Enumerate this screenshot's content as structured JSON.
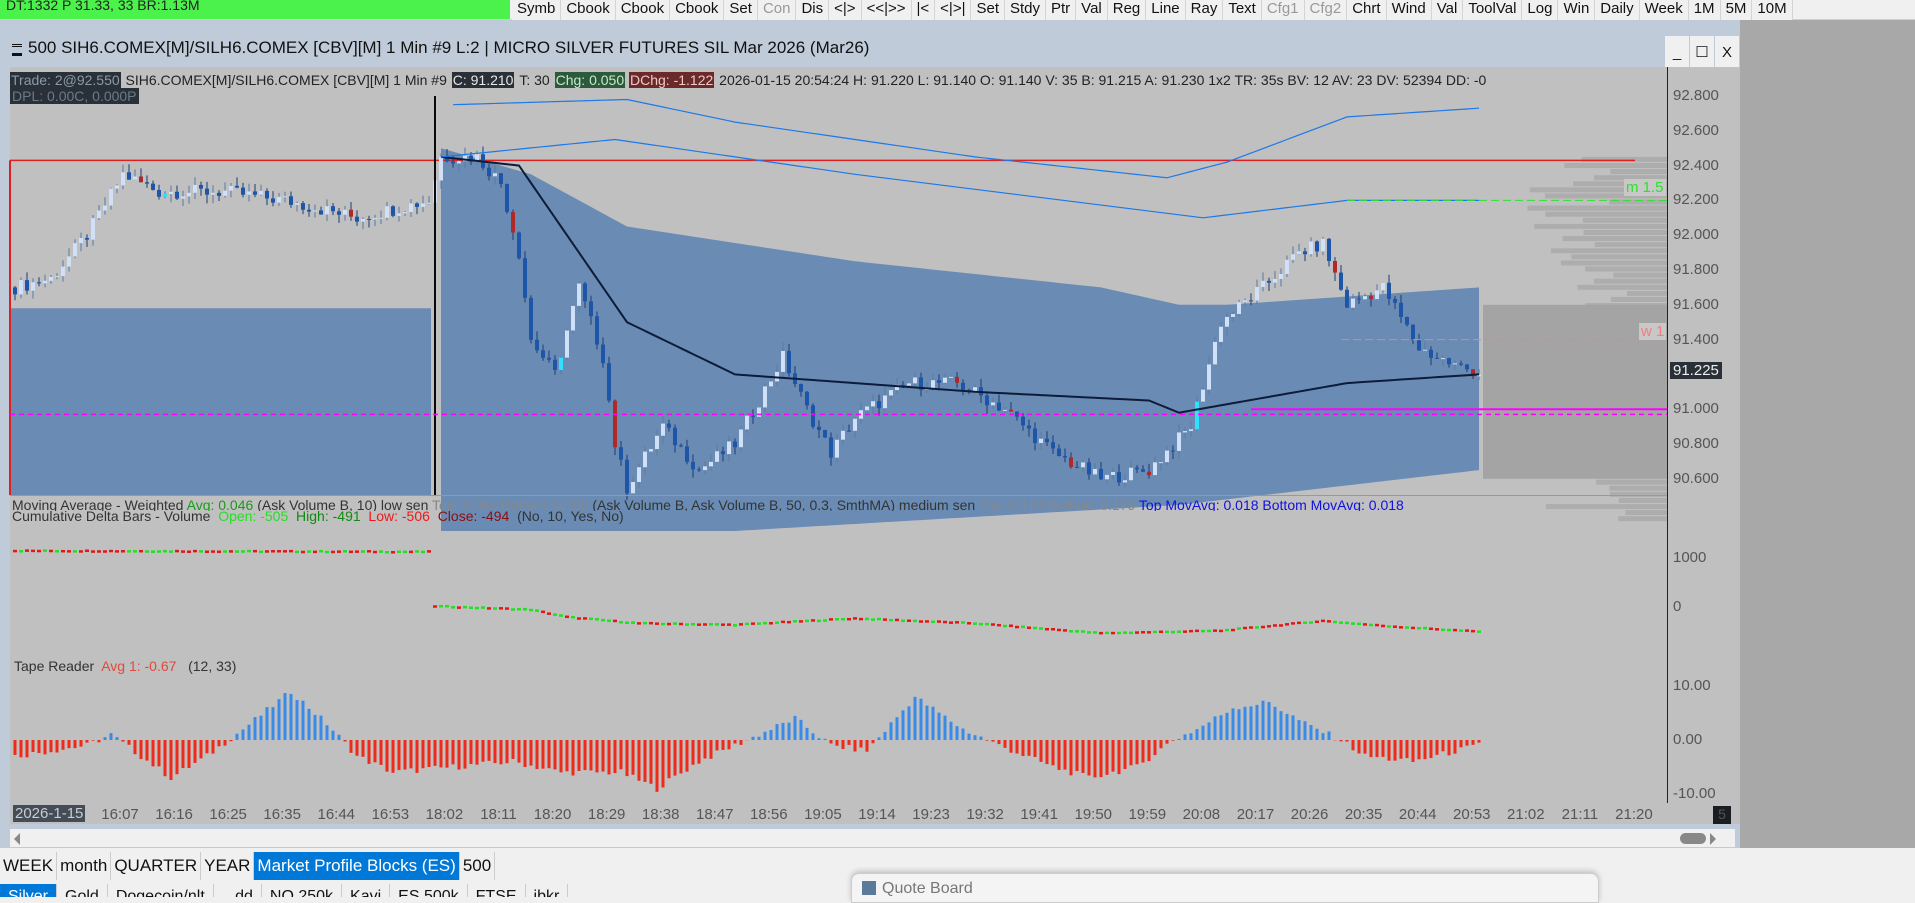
{
  "toolbar": {
    "status_text": "DT:1332 P 31.33, 33 BR:1.13M",
    "buttons": [
      "Symb",
      "Cbook",
      "Cbook",
      "Cbook",
      "Set",
      "Con",
      "Dis",
      "<|>",
      "<<|>>",
      "|<",
      "<|>|",
      "Set",
      "Stdy",
      "Ptr",
      "Val",
      "Reg",
      "Line",
      "Ray",
      "Text",
      "Cfg1",
      "Cfg2",
      "Chrt",
      "Wind",
      "Val",
      "ToolVal",
      "Log",
      "Win",
      "Daily",
      "Week",
      "1M",
      "5M",
      "10M"
    ],
    "disabled": [
      "Con",
      "Cfg1",
      "Cfg2"
    ]
  },
  "window": {
    "title": "500 SIH6.COMEX[M]/SILH6.COMEX [CBV][M]  1 Min  #9 L:2 | MICRO SILVER FUTURES SIL Mar 2026 (Mar26)",
    "minimize": "_",
    "maximize": "☐",
    "close": "X"
  },
  "info": {
    "trade": "Trade: 2@92.550",
    "symbol": "SIH6.COMEX[M]/SILH6.COMEX [CBV][M]  1 Min  #9",
    "close": "C: 91.210",
    "ticks": "T: 30",
    "chg": "Chg: 0.050",
    "dchg": "DChg: -1.122",
    "rest": "2026-01-15 20:54:24 H: 91.220 L: 91.140 O: 91.140 V: 35 B: 91.215 A: 91.230 1x2 TR: 35s BV: 12 AV: 23 DV: 52394 DD: -0",
    "dpl": "DPL: 0.00C, 0.000P"
  },
  "ma_study": {
    "name": "Moving Average - Weighted",
    "avg": "Avg: 0.046",
    "params": "(Ask Volume B, 10) low sen",
    "top": "Top: 0.069",
    "bottom": "Bottom: 0.100",
    "params2": "(Ask Volume B, Ask Volume B, 50, 0.3, SmthMA) medium sen",
    "top2": "Top: 0.143",
    "bottom2": "Bottom: 0.179",
    "topmov": "Top MovAvg: 0.018",
    "botmov": "Bottom MovAvg: 0.018"
  },
  "delta_study": {
    "name": "Cumulative Delta Bars - Volume",
    "open": "Open: -505",
    "high": "High: -491",
    "low": "Low: -506",
    "close": "Close: -494",
    "params": "(No, 10, Yes, No)"
  },
  "tape_study": {
    "name": "Tape Reader",
    "avg": "Avg 1: -0.67",
    "params": "(12, 33)"
  },
  "price_axis": {
    "labels": [
      "92.800",
      "92.600",
      "92.400",
      "92.200",
      "92.000",
      "91.800",
      "91.600",
      "91.400",
      "91.200",
      "91.000",
      "90.800",
      "90.600"
    ],
    "current": "91.225"
  },
  "delta_axis": [
    "1000",
    "0"
  ],
  "tape_axis": [
    "10.00",
    "0.00",
    "-10.00"
  ],
  "levels": {
    "m_label": "m 1.5",
    "w_label": "w 1",
    "red_line": 92.43,
    "magenta_dashed": 90.97,
    "magenta_solid": 91.0,
    "green_level": 92.2,
    "salmon_level": 91.4
  },
  "time_axis": {
    "date": "2026-1-15",
    "labels": [
      "16:07",
      "16:16",
      "16:25",
      "16:35",
      "16:44",
      "16:53",
      "18:02",
      "18:11",
      "18:20",
      "18:29",
      "18:38",
      "18:47",
      "18:56",
      "19:05",
      "19:14",
      "19:23",
      "19:32",
      "19:41",
      "19:50",
      "19:59",
      "20:08",
      "20:17",
      "20:26",
      "20:35",
      "20:44",
      "20:53",
      "21:02",
      "21:11",
      "21:20"
    ],
    "corner": "5"
  },
  "tabs": [
    "WEEK",
    "month",
    "QUARTER",
    "YEAR",
    "Market Profile Blocks (ES)",
    "500"
  ],
  "active_tab": "Market Profile Blocks (ES)",
  "tabs2": [
    "Silver",
    "Gold",
    "Dogecoin/nlt",
    "...dd",
    "NQ 250k",
    "Kavi",
    "ES 500k",
    "FTSE",
    "ibkr"
  ],
  "quote_board": {
    "title": "Quote Board"
  },
  "chart_data": {
    "type": "candlestick",
    "price_path": [
      [
        0,
        91.7
      ],
      [
        6,
        91.75
      ],
      [
        12,
        92.0
      ],
      [
        18,
        92.35
      ],
      [
        24,
        92.25
      ],
      [
        35,
        92.25
      ],
      [
        45,
        92.2
      ],
      [
        57,
        92.1
      ],
      [
        69,
        92.2
      ],
      [
        71,
        92.45
      ],
      [
        77,
        92.45
      ],
      [
        81,
        92.3
      ],
      [
        84,
        91.9
      ],
      [
        86,
        91.4
      ],
      [
        90,
        91.2
      ],
      [
        94,
        91.7
      ],
      [
        98,
        91.3
      ],
      [
        100,
        90.8
      ],
      [
        102,
        90.55
      ],
      [
        108,
        90.9
      ],
      [
        114,
        90.65
      ],
      [
        120,
        90.8
      ],
      [
        128,
        91.3
      ],
      [
        132,
        91.0
      ],
      [
        136,
        90.75
      ],
      [
        140,
        90.95
      ],
      [
        149,
        91.15
      ],
      [
        157,
        91.15
      ],
      [
        165,
        91.0
      ],
      [
        173,
        90.75
      ],
      [
        181,
        90.6
      ],
      [
        189,
        90.65
      ],
      [
        196,
        90.9
      ],
      [
        201,
        91.5
      ],
      [
        208,
        91.7
      ],
      [
        214,
        91.9
      ],
      [
        218,
        91.95
      ],
      [
        222,
        91.6
      ],
      [
        228,
        91.7
      ],
      [
        234,
        91.35
      ],
      [
        240,
        91.25
      ],
      [
        244,
        91.21
      ]
    ],
    "vwap": [
      [
        71,
        92.45
      ],
      [
        84,
        92.4
      ],
      [
        94,
        91.9
      ],
      [
        102,
        91.5
      ],
      [
        120,
        91.2
      ],
      [
        160,
        91.1
      ],
      [
        189,
        91.05
      ],
      [
        194,
        90.98
      ],
      [
        222,
        91.15
      ],
      [
        244,
        91.2
      ]
    ],
    "band_upper": [
      [
        71,
        92.5
      ],
      [
        86,
        92.35
      ],
      [
        102,
        92.05
      ],
      [
        140,
        91.85
      ],
      [
        181,
        91.7
      ],
      [
        194,
        91.6
      ],
      [
        202,
        91.6
      ],
      [
        244,
        91.7
      ]
    ],
    "band_lower": [
      [
        71,
        90.3
      ],
      [
        120,
        90.3
      ],
      [
        194,
        90.45
      ],
      [
        244,
        90.65
      ]
    ],
    "outer_upper": [
      [
        73,
        92.75
      ],
      [
        102,
        92.78
      ],
      [
        120,
        92.65
      ],
      [
        160,
        92.45
      ],
      [
        192,
        92.33
      ],
      [
        202,
        92.42
      ],
      [
        222,
        92.68
      ],
      [
        244,
        92.73
      ]
    ],
    "outer_mid": [
      [
        71,
        92.45
      ],
      [
        100,
        92.55
      ],
      [
        140,
        92.35
      ],
      [
        198,
        92.1
      ],
      [
        222,
        92.2
      ],
      [
        244,
        92.2
      ]
    ],
    "session_band_top": 91.58,
    "cum_delta": [
      [
        0,
        1150
      ],
      [
        69,
        1130
      ],
      [
        70,
        20
      ],
      [
        86,
        -50
      ],
      [
        92,
        -200
      ],
      [
        104,
        -330
      ],
      [
        120,
        -360
      ],
      [
        140,
        -230
      ],
      [
        160,
        -330
      ],
      [
        181,
        -530
      ],
      [
        201,
        -480
      ],
      [
        218,
        -280
      ],
      [
        228,
        -380
      ],
      [
        244,
        -500
      ]
    ],
    "tape": [
      [
        0,
        -3
      ],
      [
        12,
        -1
      ],
      [
        16,
        1
      ],
      [
        26,
        -7
      ],
      [
        32,
        -3
      ],
      [
        38,
        2
      ],
      [
        46,
        9
      ],
      [
        52,
        3
      ],
      [
        57,
        -3
      ],
      [
        63,
        -6
      ],
      [
        73,
        -5
      ],
      [
        83,
        -4
      ],
      [
        91,
        -6
      ],
      [
        101,
        -6
      ],
      [
        107,
        -9
      ],
      [
        114,
        -4
      ],
      [
        122,
        0
      ],
      [
        130,
        4
      ],
      [
        136,
        -1
      ],
      [
        142,
        -2
      ],
      [
        150,
        8
      ],
      [
        158,
        2
      ],
      [
        164,
        -1
      ],
      [
        173,
        -5
      ],
      [
        179,
        -7
      ],
      [
        187,
        -5
      ],
      [
        193,
        0
      ],
      [
        197,
        2
      ],
      [
        203,
        6
      ],
      [
        209,
        7
      ],
      [
        215,
        3
      ],
      [
        221,
        0
      ],
      [
        225,
        -3
      ],
      [
        233,
        -4
      ],
      [
        244,
        -1
      ]
    ]
  }
}
